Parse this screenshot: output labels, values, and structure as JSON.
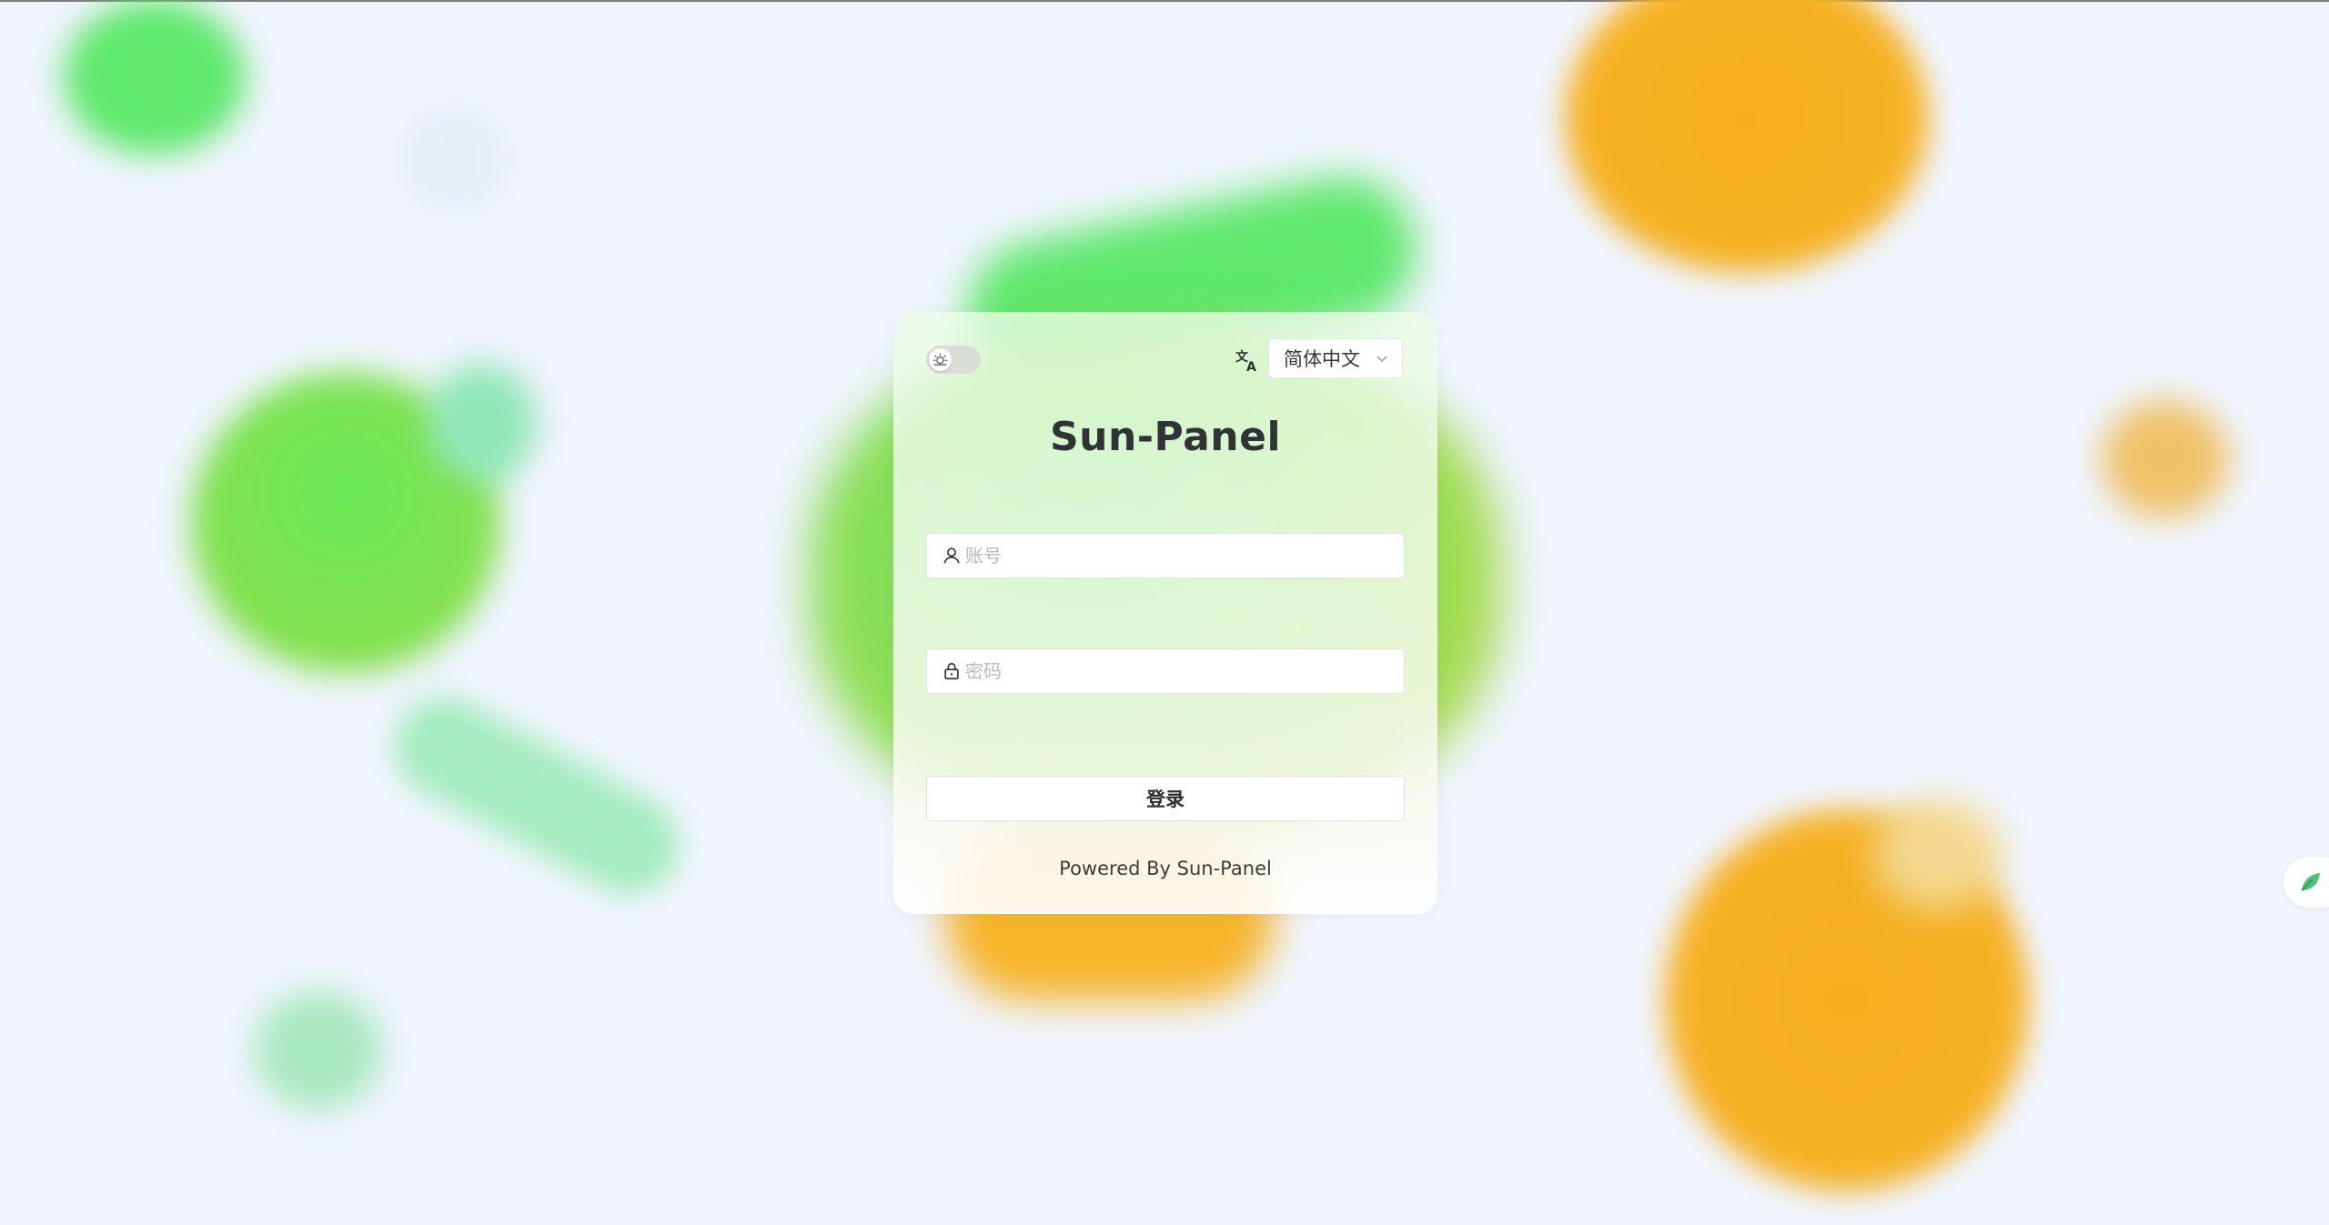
{
  "app": {
    "title": "Sun-Panel"
  },
  "header": {
    "theme_toggle": {
      "state": "light",
      "icon": "sun-icon"
    },
    "language": {
      "icon": "translate-icon",
      "selected": "简体中文"
    }
  },
  "form": {
    "username": {
      "placeholder": "账号",
      "value": "",
      "icon": "user-icon"
    },
    "password": {
      "placeholder": "密码",
      "value": "",
      "icon": "lock-icon"
    },
    "login_label": "登录"
  },
  "footer": {
    "powered_by": "Powered By Sun-Panel"
  },
  "side_widget": {
    "icon": "leaf-icon"
  },
  "colors": {
    "background": "#f0f5fd",
    "green_accent": "#5ee86c",
    "orange_accent": "#f5ae1a",
    "text_dark": "#2f3336"
  }
}
